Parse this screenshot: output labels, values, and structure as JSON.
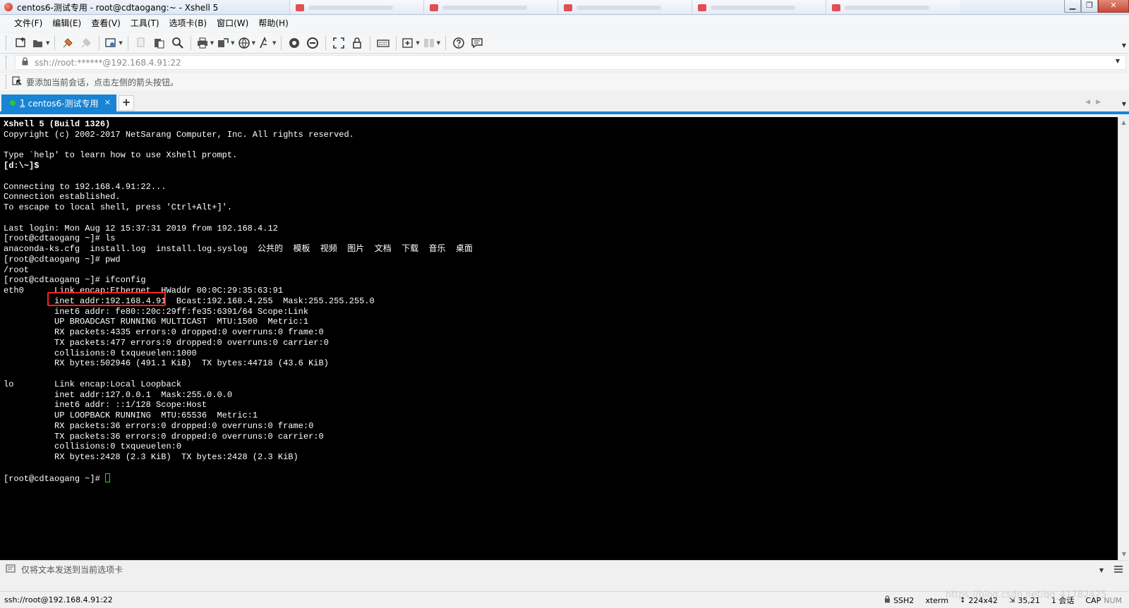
{
  "window": {
    "title": "centos6-测试专用 - root@cdtaogang:~ - Xshell 5",
    "buttons": {
      "minimize": "▁",
      "maximize": "❐",
      "close": "✕"
    }
  },
  "menu": {
    "items": [
      "文件(F)",
      "编辑(E)",
      "查看(V)",
      "工具(T)",
      "选项卡(B)",
      "窗口(W)",
      "帮助(H)"
    ]
  },
  "toolbar": {
    "icons": [
      "new-session-icon",
      "open-icon",
      "reconnect-icon",
      "disconnect-icon",
      "properties-icon",
      "copy-icon",
      "paste-icon",
      "find-icon",
      "print-icon",
      "transfer-icon",
      "globe-icon",
      "font-icon",
      "xftp-icon",
      "xmanager-icon",
      "fullscreen-icon",
      "lock-icon",
      "keyboard-icon",
      "add-icon",
      "layout-icon",
      "help-icon",
      "chat-icon"
    ]
  },
  "address": {
    "value": "ssh://root:******@192.168.4.91:22"
  },
  "links": {
    "hint": "要添加当前会话，点击左侧的箭头按钮。"
  },
  "tabs": {
    "active": {
      "number": "1",
      "label": "centos6-测试专用",
      "status_color": "#27c63c"
    },
    "add_label": "+"
  },
  "terminal": {
    "lines": [
      "Xshell 5 (Build 1326)",
      "Copyright (c) 2002-2017 NetSarang Computer, Inc. All rights reserved.",
      "",
      "Type `help' to learn how to use Xshell prompt.",
      "[d:\\~]$",
      "",
      "Connecting to 192.168.4.91:22...",
      "Connection established.",
      "To escape to local shell, press 'Ctrl+Alt+]'.",
      "",
      "Last login: Mon Aug 12 15:37:31 2019 from 192.168.4.12",
      "[root@cdtaogang ~]# ls",
      "anaconda-ks.cfg  install.log  install.log.syslog  公共的  模板  视频  图片  文档  下载  音乐  桌面",
      "[root@cdtaogang ~]# pwd",
      "/root",
      "[root@cdtaogang ~]# ifconfig",
      "eth0      Link encap:Ethernet  HWaddr 00:0C:29:35:63:91",
      "          inet addr:192.168.4.91  Bcast:192.168.4.255  Mask:255.255.255.0",
      "          inet6 addr: fe80::20c:29ff:fe35:6391/64 Scope:Link",
      "          UP BROADCAST RUNNING MULTICAST  MTU:1500  Metric:1",
      "          RX packets:4335 errors:0 dropped:0 overruns:0 frame:0",
      "          TX packets:477 errors:0 dropped:0 overruns:0 carrier:0",
      "          collisions:0 txqueuelen:1000",
      "          RX bytes:502946 (491.1 KiB)  TX bytes:44718 (43.6 KiB)",
      "",
      "lo        Link encap:Local Loopback",
      "          inet addr:127.0.0.1  Mask:255.0.0.0",
      "          inet6 addr: ::1/128 Scope:Host",
      "          UP LOOPBACK RUNNING  MTU:65536  Metric:1",
      "          RX packets:36 errors:0 dropped:0 overruns:0 frame:0",
      "          TX packets:36 errors:0 dropped:0 overruns:0 carrier:0",
      "          collisions:0 txqueuelen:0",
      "          RX bytes:2428 (2.3 KiB)  TX bytes:2428 (2.3 KiB)",
      "",
      "[root@cdtaogang ~]# "
    ],
    "bold_lines": [
      0,
      4
    ],
    "cursor_color": "#15e01f",
    "highlight_color": "#ff2020"
  },
  "compose": {
    "hint": "仅将文本发送到当前选项卡"
  },
  "status": {
    "connection": "ssh://root@192.168.4.91:22",
    "protocol": "SSH2",
    "terminal_type": "xterm",
    "size": "224x42",
    "cursor_pos": "35,21",
    "sessions": "1 会话",
    "caps": "CAP",
    "num": "NUM"
  },
  "watermark": "https://blog.csdn.net/qq_41782425"
}
